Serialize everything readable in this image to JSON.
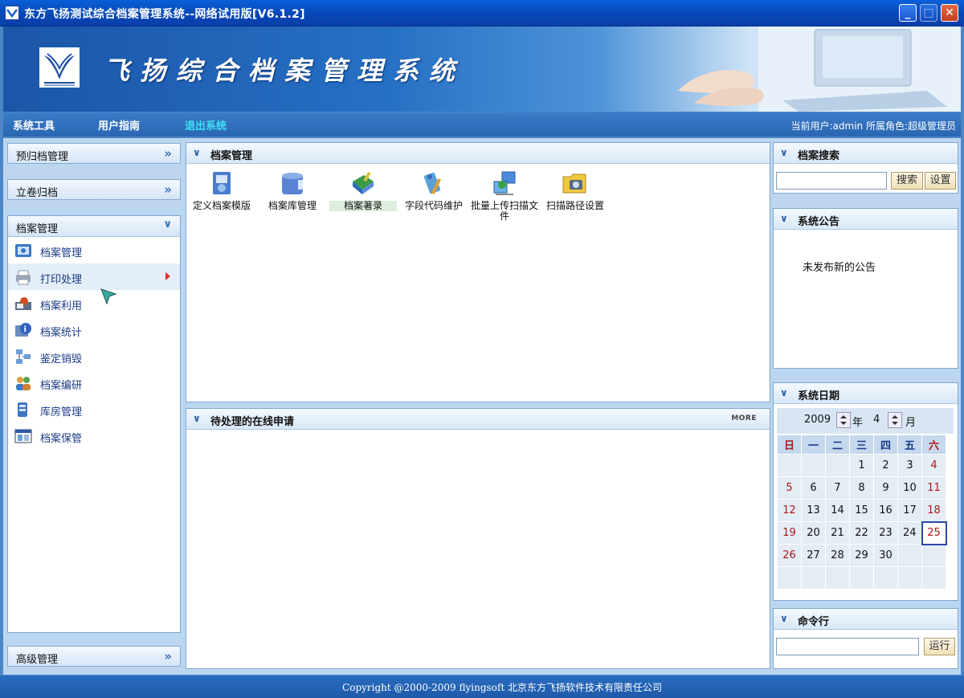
{
  "window": {
    "title": "东方飞扬测试综合档案管理系统--网络试用版[V6.1.2]",
    "controls": {
      "minimize": "_",
      "maximize": "□",
      "close": "✕"
    }
  },
  "banner": {
    "title": "飞扬综合档案管理系统"
  },
  "menubar": {
    "items": [
      "系统工具",
      "用户指南",
      "退出系统"
    ],
    "user_info": "当前用户:admin  所属角色:超级管理员"
  },
  "left_nav": {
    "sections": [
      {
        "label": "预归档管理",
        "chevron": "»"
      },
      {
        "label": "立卷归档",
        "chevron": "»"
      },
      {
        "label": "档案管理",
        "chevron": "∨"
      }
    ],
    "items": [
      {
        "label": "档案管理",
        "icon": "archive-icon"
      },
      {
        "label": "打印处理",
        "icon": "printer-icon"
      },
      {
        "label": "档案利用",
        "icon": "user-document-icon"
      },
      {
        "label": "档案统计",
        "icon": "info-icon"
      },
      {
        "label": "鉴定销毁",
        "icon": "network-icon"
      },
      {
        "label": "档案编研",
        "icon": "people-icon"
      },
      {
        "label": "库房管理",
        "icon": "storage-icon"
      },
      {
        "label": "档案保管",
        "icon": "window-icon"
      }
    ],
    "bottom_section": {
      "label": "高级管理",
      "chevron": "»"
    }
  },
  "center": {
    "archive_panel": {
      "title": "档案管理",
      "icons": [
        {
          "label": "定义档案模版",
          "icon": "template-icon"
        },
        {
          "label": "档案库管理",
          "icon": "database-icon"
        },
        {
          "label": "档案著录",
          "icon": "catalog-icon"
        },
        {
          "label": "字段代码维护",
          "icon": "code-tools-icon"
        },
        {
          "label": "批量上传扫描文件",
          "icon": "upload-scan-icon"
        },
        {
          "label": "扫描路径设置",
          "icon": "scan-path-icon"
        }
      ]
    },
    "pending_panel": {
      "title": "待处理的在线申请",
      "more": "MORE"
    }
  },
  "right": {
    "search": {
      "title": "档案搜索",
      "value": "",
      "search_btn": "搜索",
      "settings_btn": "设置"
    },
    "notice": {
      "title": "系统公告",
      "text": "未发布新的公告"
    },
    "date": {
      "title": "系统日期",
      "year": "2009",
      "year_suffix": "年",
      "month": "4",
      "month_suffix": "月",
      "weekdays": [
        "日",
        "一",
        "二",
        "三",
        "四",
        "五",
        "六"
      ],
      "weeks": [
        [
          "",
          "",
          "",
          "1",
          "2",
          "3",
          "4"
        ],
        [
          "5",
          "6",
          "7",
          "8",
          "9",
          "10",
          "11"
        ],
        [
          "12",
          "13",
          "14",
          "15",
          "16",
          "17",
          "18"
        ],
        [
          "19",
          "20",
          "21",
          "22",
          "23",
          "24",
          "25"
        ],
        [
          "26",
          "27",
          "28",
          "29",
          "30",
          "",
          ""
        ],
        [
          "",
          "",
          "",
          "",
          "",
          "",
          ""
        ]
      ],
      "today": "25"
    },
    "command": {
      "title": "命令行",
      "value": "",
      "run_btn": "运行"
    }
  },
  "footer": {
    "text": "Copyright @2000-2009 flyingsoft 北京东方飞扬软件技术有限责任公司"
  }
}
